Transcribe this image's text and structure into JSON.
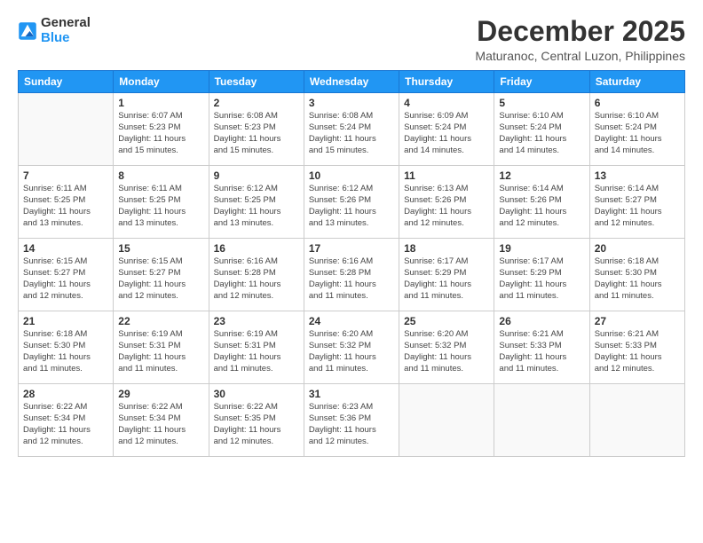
{
  "logo": {
    "line1": "General",
    "line2": "Blue"
  },
  "title": "December 2025",
  "subtitle": "Maturanoc, Central Luzon, Philippines",
  "days_of_week": [
    "Sunday",
    "Monday",
    "Tuesday",
    "Wednesday",
    "Thursday",
    "Friday",
    "Saturday"
  ],
  "weeks": [
    [
      {
        "day": "",
        "info": ""
      },
      {
        "day": "1",
        "info": "Sunrise: 6:07 AM\nSunset: 5:23 PM\nDaylight: 11 hours\nand 15 minutes."
      },
      {
        "day": "2",
        "info": "Sunrise: 6:08 AM\nSunset: 5:23 PM\nDaylight: 11 hours\nand 15 minutes."
      },
      {
        "day": "3",
        "info": "Sunrise: 6:08 AM\nSunset: 5:24 PM\nDaylight: 11 hours\nand 15 minutes."
      },
      {
        "day": "4",
        "info": "Sunrise: 6:09 AM\nSunset: 5:24 PM\nDaylight: 11 hours\nand 14 minutes."
      },
      {
        "day": "5",
        "info": "Sunrise: 6:10 AM\nSunset: 5:24 PM\nDaylight: 11 hours\nand 14 minutes."
      },
      {
        "day": "6",
        "info": "Sunrise: 6:10 AM\nSunset: 5:24 PM\nDaylight: 11 hours\nand 14 minutes."
      }
    ],
    [
      {
        "day": "7",
        "info": "Sunrise: 6:11 AM\nSunset: 5:25 PM\nDaylight: 11 hours\nand 13 minutes."
      },
      {
        "day": "8",
        "info": "Sunrise: 6:11 AM\nSunset: 5:25 PM\nDaylight: 11 hours\nand 13 minutes."
      },
      {
        "day": "9",
        "info": "Sunrise: 6:12 AM\nSunset: 5:25 PM\nDaylight: 11 hours\nand 13 minutes."
      },
      {
        "day": "10",
        "info": "Sunrise: 6:12 AM\nSunset: 5:26 PM\nDaylight: 11 hours\nand 13 minutes."
      },
      {
        "day": "11",
        "info": "Sunrise: 6:13 AM\nSunset: 5:26 PM\nDaylight: 11 hours\nand 12 minutes."
      },
      {
        "day": "12",
        "info": "Sunrise: 6:14 AM\nSunset: 5:26 PM\nDaylight: 11 hours\nand 12 minutes."
      },
      {
        "day": "13",
        "info": "Sunrise: 6:14 AM\nSunset: 5:27 PM\nDaylight: 11 hours\nand 12 minutes."
      }
    ],
    [
      {
        "day": "14",
        "info": "Sunrise: 6:15 AM\nSunset: 5:27 PM\nDaylight: 11 hours\nand 12 minutes."
      },
      {
        "day": "15",
        "info": "Sunrise: 6:15 AM\nSunset: 5:27 PM\nDaylight: 11 hours\nand 12 minutes."
      },
      {
        "day": "16",
        "info": "Sunrise: 6:16 AM\nSunset: 5:28 PM\nDaylight: 11 hours\nand 12 minutes."
      },
      {
        "day": "17",
        "info": "Sunrise: 6:16 AM\nSunset: 5:28 PM\nDaylight: 11 hours\nand 11 minutes."
      },
      {
        "day": "18",
        "info": "Sunrise: 6:17 AM\nSunset: 5:29 PM\nDaylight: 11 hours\nand 11 minutes."
      },
      {
        "day": "19",
        "info": "Sunrise: 6:17 AM\nSunset: 5:29 PM\nDaylight: 11 hours\nand 11 minutes."
      },
      {
        "day": "20",
        "info": "Sunrise: 6:18 AM\nSunset: 5:30 PM\nDaylight: 11 hours\nand 11 minutes."
      }
    ],
    [
      {
        "day": "21",
        "info": "Sunrise: 6:18 AM\nSunset: 5:30 PM\nDaylight: 11 hours\nand 11 minutes."
      },
      {
        "day": "22",
        "info": "Sunrise: 6:19 AM\nSunset: 5:31 PM\nDaylight: 11 hours\nand 11 minutes."
      },
      {
        "day": "23",
        "info": "Sunrise: 6:19 AM\nSunset: 5:31 PM\nDaylight: 11 hours\nand 11 minutes."
      },
      {
        "day": "24",
        "info": "Sunrise: 6:20 AM\nSunset: 5:32 PM\nDaylight: 11 hours\nand 11 minutes."
      },
      {
        "day": "25",
        "info": "Sunrise: 6:20 AM\nSunset: 5:32 PM\nDaylight: 11 hours\nand 11 minutes."
      },
      {
        "day": "26",
        "info": "Sunrise: 6:21 AM\nSunset: 5:33 PM\nDaylight: 11 hours\nand 11 minutes."
      },
      {
        "day": "27",
        "info": "Sunrise: 6:21 AM\nSunset: 5:33 PM\nDaylight: 11 hours\nand 12 minutes."
      }
    ],
    [
      {
        "day": "28",
        "info": "Sunrise: 6:22 AM\nSunset: 5:34 PM\nDaylight: 11 hours\nand 12 minutes."
      },
      {
        "day": "29",
        "info": "Sunrise: 6:22 AM\nSunset: 5:34 PM\nDaylight: 11 hours\nand 12 minutes."
      },
      {
        "day": "30",
        "info": "Sunrise: 6:22 AM\nSunset: 5:35 PM\nDaylight: 11 hours\nand 12 minutes."
      },
      {
        "day": "31",
        "info": "Sunrise: 6:23 AM\nSunset: 5:36 PM\nDaylight: 11 hours\nand 12 minutes."
      },
      {
        "day": "",
        "info": ""
      },
      {
        "day": "",
        "info": ""
      },
      {
        "day": "",
        "info": ""
      }
    ]
  ]
}
